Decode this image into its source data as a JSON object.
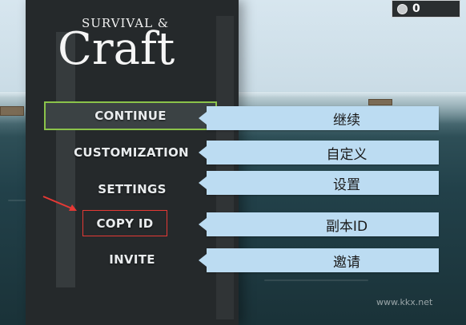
{
  "logo": {
    "line1": "SURVIVAL &",
    "line2": "Craft"
  },
  "currency": {
    "value": "0",
    "icon": "coin-icon"
  },
  "menu": {
    "continue": "CONTINUE",
    "customization": "CUSTOMIZATION",
    "settings": "SETTINGS",
    "copy_id": "COPY ID",
    "invite": "INVITE"
  },
  "labels": {
    "continue": "继续",
    "customization": "自定义",
    "settings": "设置",
    "copy_id": "副本ID",
    "invite": "邀请"
  },
  "watermark": "www.kkx.net",
  "colors": {
    "selected_border": "#8bc34a",
    "highlight_border": "#e53935",
    "label_bg": "#bcdcf2"
  }
}
